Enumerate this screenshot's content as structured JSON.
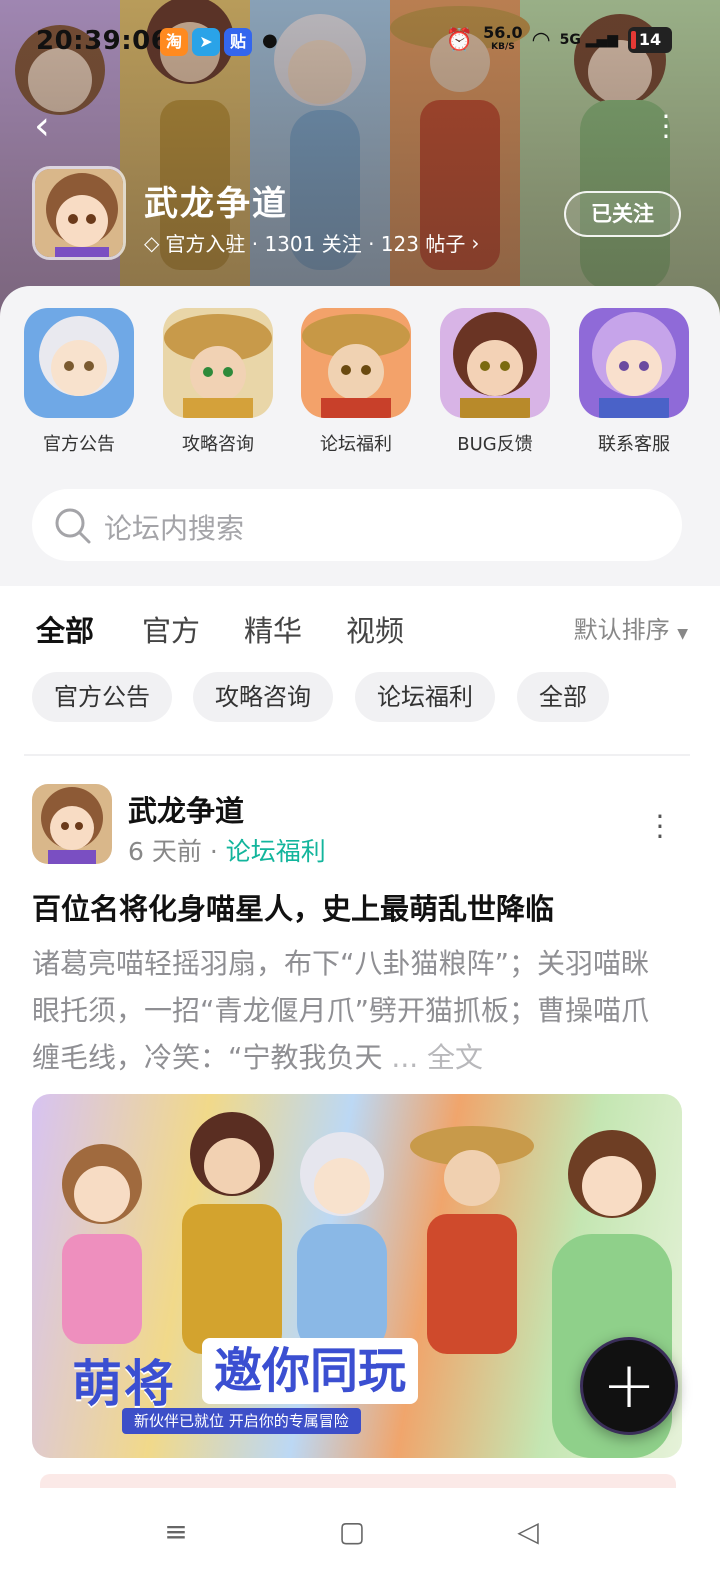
{
  "status_bar": {
    "time": "20:39:06",
    "app_icons": [
      "taobao-icon",
      "telegram-icon",
      "tieba-icon"
    ],
    "net_speed": "56.0",
    "net_unit": "KB/S",
    "signal": "5G",
    "battery": "14"
  },
  "header": {
    "forum_name": "武龙争道",
    "meta": "官方入驻 · 1301 关注 · 123 帖子",
    "follow_label": "已关注"
  },
  "categories": [
    {
      "label": "官方公告"
    },
    {
      "label": "攻略咨询"
    },
    {
      "label": "论坛福利"
    },
    {
      "label": "BUG反馈"
    },
    {
      "label": "联系客服"
    }
  ],
  "search": {
    "placeholder": "论坛内搜索"
  },
  "tabs": [
    {
      "label": "全部",
      "active": true
    },
    {
      "label": "官方"
    },
    {
      "label": "精华"
    },
    {
      "label": "视频"
    }
  ],
  "sort_label": "默认排序",
  "chips": [
    "官方公告",
    "攻略咨询",
    "论坛福利",
    "全部"
  ],
  "post": {
    "author": "武龙争道",
    "time": "6 天前",
    "tag": "论坛福利",
    "title": "百位名将化身喵星人，史上最萌乱世降临",
    "body": "诸葛亮喵轻摇羽扇，布下“八卦猫粮阵”；关羽喵眯眼托须，一招“青龙偃月爪”劈开猫抓板；曹操喵爪缠毛线，冷笑：“宁教我负天",
    "ellipsis": " ... ",
    "full_label": "全文",
    "banner_title_a": "萌将",
    "banner_title_b": "邀你同玩",
    "banner_sub": "新伙伴已就位  开启你的专属冒险"
  },
  "colors": {
    "accent": "#19c1a8",
    "tag": "#13b59c",
    "banner_text": "#3b4fd1"
  }
}
